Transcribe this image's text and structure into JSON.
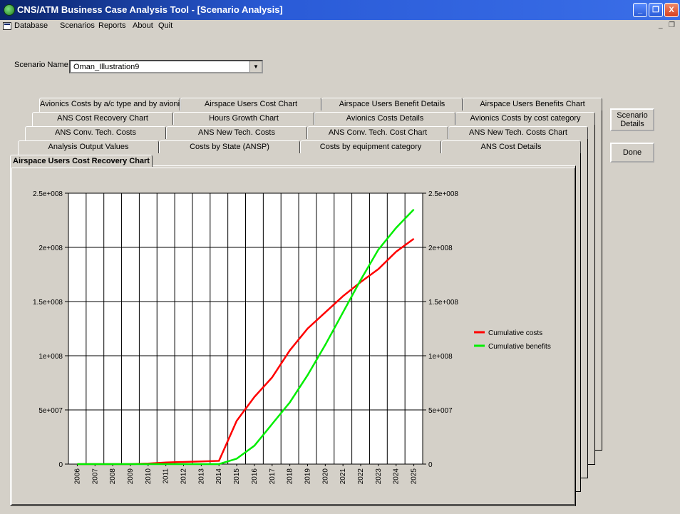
{
  "window": {
    "title": "CNS/ATM Business Case Analysis Tool - [Scenario Analysis]",
    "minimize_label": "_",
    "restore_label": "❐",
    "close_label": "X"
  },
  "menu": {
    "items": [
      "Database",
      "Scenarios",
      "Reports",
      "About",
      "Quit"
    ],
    "mdi_minimize": "_",
    "mdi_restore": "❐"
  },
  "scenario": {
    "label": "Scenario Name:",
    "value": "Oman_Illustration9"
  },
  "buttons": {
    "scenario_details": "Scenario Details",
    "done": "Done"
  },
  "tabs": {
    "row1": [
      "Avionics Costs by a/c type and by avionic",
      "Airspace Users Cost Chart",
      "Airspace Users Benefit Details",
      "Airspace Users Benefits Chart"
    ],
    "row2": [
      "ANS Cost Recovery Chart",
      "Hours Growth Chart",
      "Avionics Costs Details",
      "Avionics Costs by cost category"
    ],
    "row3": [
      "ANS Conv. Tech. Costs",
      "ANS New Tech. Costs",
      "ANS Conv. Tech. Cost Chart",
      "ANS New Tech. Costs Chart"
    ],
    "row4": [
      "Analysis Output Values",
      "Costs by State (ANSP)",
      "Costs by equipment category",
      "ANS Cost Details"
    ],
    "active": "Airspace Users Cost Recovery Chart"
  },
  "chart_data": {
    "type": "line",
    "title": "",
    "x": [
      "2006",
      "2007",
      "2008",
      "2009",
      "2010",
      "2011",
      "2012",
      "2013",
      "2014",
      "2015",
      "2016",
      "2017",
      "2018",
      "2019",
      "2020",
      "2021",
      "2022",
      "2023",
      "2024",
      "2025"
    ],
    "ylim": [
      0,
      250000000
    ],
    "yticks": [
      0,
      50000000,
      100000000,
      150000000,
      200000000,
      250000000
    ],
    "ytick_labels": [
      "0",
      "5e+007",
      "1e+008",
      "1.5e+008",
      "2e+008",
      "2.5e+008"
    ],
    "grid": true,
    "legend_position": "right",
    "series": [
      {
        "name": "Cumulative costs",
        "color": "#ff0000",
        "values": [
          0,
          0,
          0,
          0,
          500000,
          1500000,
          2000000,
          2500000,
          3000000,
          40000000,
          62000000,
          80000000,
          105000000,
          125000000,
          140000000,
          155000000,
          168000000,
          180000000,
          196000000,
          208000000
        ]
      },
      {
        "name": "Cumulative benefits",
        "color": "#00ee00",
        "values": [
          0,
          0,
          0,
          0,
          0,
          0,
          0,
          0,
          0,
          5000000,
          17000000,
          37000000,
          57000000,
          82000000,
          110000000,
          140000000,
          170000000,
          198000000,
          218000000,
          235000000
        ]
      }
    ]
  }
}
